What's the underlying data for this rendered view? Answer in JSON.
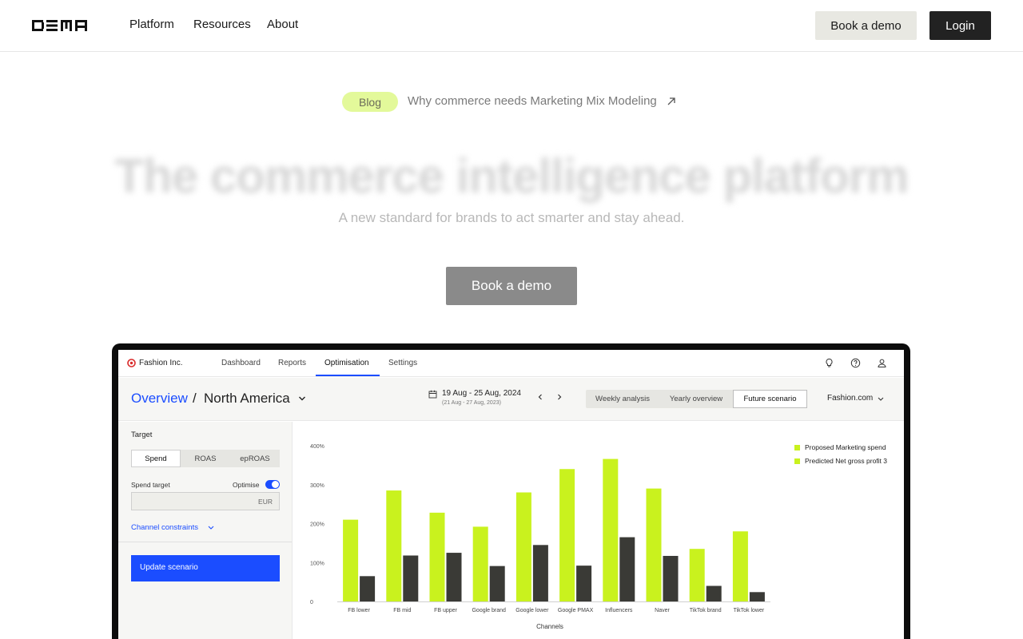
{
  "nav": {
    "links": [
      "Platform",
      "Resources",
      "About"
    ],
    "book_demo": "Book a demo",
    "login": "Login"
  },
  "hero": {
    "blog_badge": "Blog",
    "blog_link": "Why commerce needs Marketing Mix Modeling",
    "title": "The commerce intelligence platform",
    "subtitle": "A new standard for brands to act smarter and stay ahead.",
    "cta": "Book a demo"
  },
  "app": {
    "brand": "Fashion Inc.",
    "tabs": [
      {
        "label": "Dashboard"
      },
      {
        "label": "Reports"
      },
      {
        "label": "Optimisation",
        "active": true
      },
      {
        "label": "Settings"
      }
    ],
    "header": {
      "breadcrumb_root": "Overview",
      "breadcrumb_sep": "/",
      "region": "North America",
      "date_range": "19 Aug - 25 Aug, 2024",
      "compare_range": "(21 Aug - 27 Aug, 2023)",
      "views": [
        "Weekly analysis",
        "Yearly overview",
        "Future scenario"
      ],
      "active_view": "Future scenario",
      "store": "Fashion.com"
    },
    "panel": {
      "target_label": "Target",
      "metrics": [
        "Spend",
        "ROAS",
        "epROAS"
      ],
      "active_metric": "Spend",
      "spend_target_label": "Spend target",
      "optimise_label": "Optimise",
      "optimise_on": true,
      "currency": "EUR",
      "constraints_label": "Channel constraints",
      "update_button": "Update scenario"
    },
    "colors": {
      "accent_blue": "#1b4dff",
      "lime": "#c9f21e",
      "dark_bar": "#3a3a36"
    }
  },
  "chart_data": {
    "type": "bar",
    "categories": [
      "FB lower",
      "FB mid",
      "FB upper",
      "Google brand",
      "Google lower",
      "Google PMAX",
      "Influencers",
      "Naver",
      "TikTok brand",
      "TikTok lower"
    ],
    "series": [
      {
        "name": "Proposed Marketing spend",
        "values": [
          210,
          285,
          228,
          192,
          280,
          340,
          366,
          290,
          135,
          180
        ],
        "color": "#c9f21e"
      },
      {
        "name": "Predicted Net gross profit 3",
        "values": [
          65,
          118,
          125,
          91,
          145,
          92,
          165,
          117,
          40,
          24
        ],
        "color": "#3a3a36"
      }
    ],
    "ylim": [
      0,
      400
    ],
    "yticks": [
      "0",
      "100%",
      "200%",
      "300%",
      "400%"
    ],
    "xlabel": "Channels",
    "legend": "top-right"
  }
}
